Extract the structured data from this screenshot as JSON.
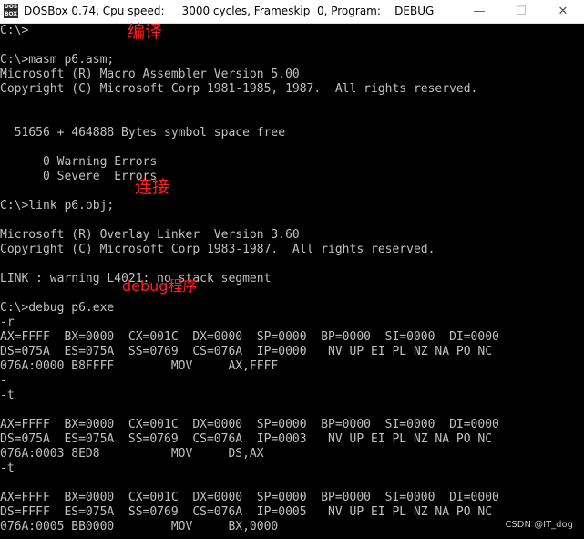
{
  "window": {
    "title": "DOSBox 0.74, Cpu speed:     3000 cycles, Frameskip  0, Program:    DEBUG",
    "icon_text": "DOS BOX",
    "buttons": {
      "minimize_icon": "minimize-icon",
      "maximize_icon": "maximize-icon",
      "close_icon": "close-icon",
      "minimize": "—",
      "maximize": "☐",
      "close": "✕"
    }
  },
  "console": {
    "lines": [
      "C:\\>",
      "",
      "C:\\>masm p6.asm;",
      "Microsoft (R) Macro Assembler Version 5.00",
      "Copyright (C) Microsoft Corp 1981-1985, 1987.  All rights reserved.",
      "",
      "",
      "  51656 + 464888 Bytes symbol space free",
      "",
      "      0 Warning Errors",
      "      0 Severe  Errors",
      "",
      "C:\\>link p6.obj;",
      "",
      "Microsoft (R) Overlay Linker  Version 3.60",
      "Copyright (C) Microsoft Corp 1983-1987.  All rights reserved.",
      "",
      "LINK : warning L4021: no stack segment",
      "",
      "C:\\>debug p6.exe",
      "-r",
      "AX=FFFF  BX=0000  CX=001C  DX=0000  SP=0000  BP=0000  SI=0000  DI=0000",
      "DS=075A  ES=075A  SS=0769  CS=076A  IP=0000   NV UP EI PL NZ NA PO NC",
      "076A:0000 B8FFFF        MOV     AX,FFFF",
      "-",
      "-t",
      "",
      "AX=FFFF  BX=0000  CX=001C  DX=0000  SP=0000  BP=0000  SI=0000  DI=0000",
      "DS=075A  ES=075A  SS=0769  CS=076A  IP=0003   NV UP EI PL NZ NA PO NC",
      "076A:0003 8ED8          MOV     DS,AX",
      "-t",
      "",
      "AX=FFFF  BX=0000  CX=001C  DX=0000  SP=0000  BP=0000  SI=0000  DI=0000",
      "DS=FFFF  ES=075A  SS=0769  CS=076A  IP=0005   NV UP EI PL NZ NA PO NC",
      "076A:0005 BB0000        MOV     BX,0000"
    ]
  },
  "annotations": {
    "compile": "编译",
    "link": "连接",
    "debug": "debug程序"
  },
  "watermark": "CSDN @IT_dog",
  "colors": {
    "console_bg": "#000000",
    "console_text": "#c0c0c0",
    "annotation": "#ff2020",
    "titlebar_bg": "#ffffff"
  }
}
